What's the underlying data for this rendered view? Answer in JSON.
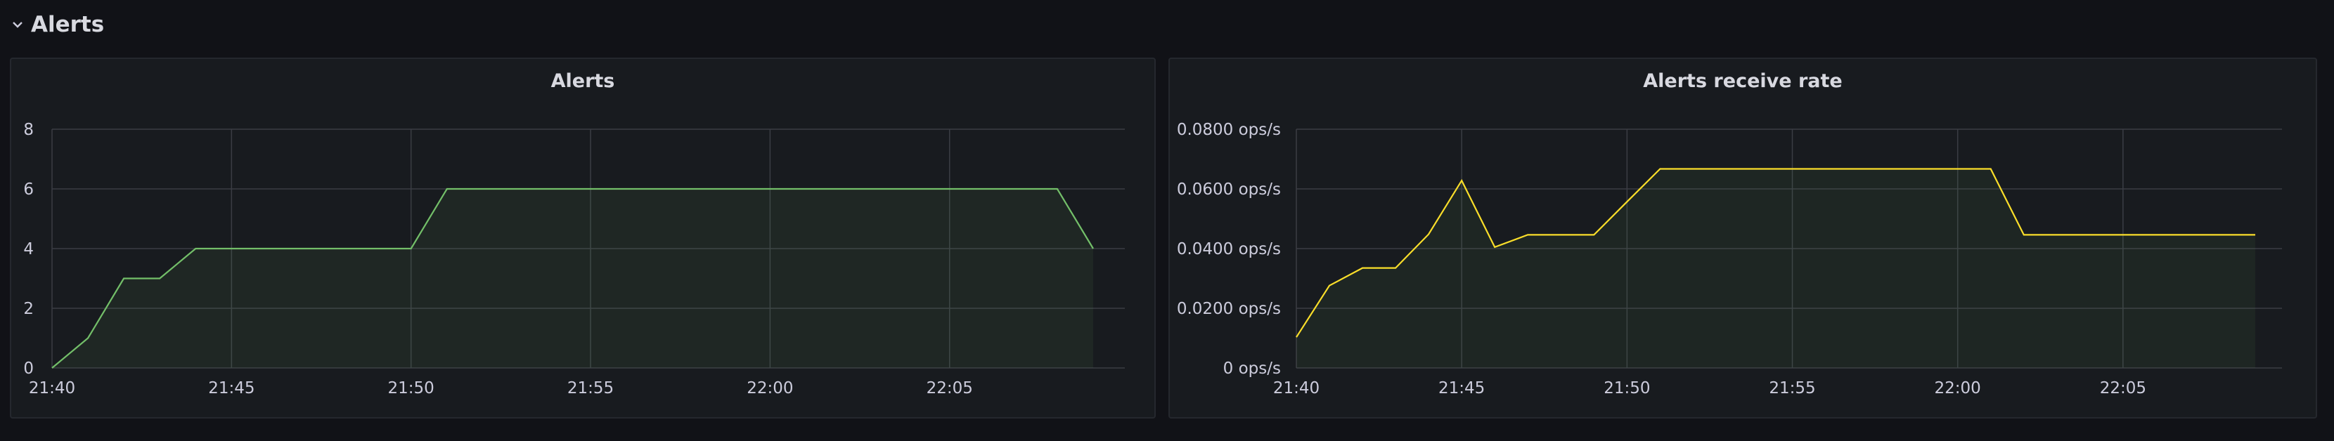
{
  "row": {
    "title": "Alerts",
    "chevron_icon": "chevron-down-icon"
  },
  "colors": {
    "background": "#111217",
    "panel_background": "#181b1f",
    "panel_border": "#25282e",
    "grid": "#3a3d44",
    "text": "#ccccdc",
    "alerts_series": "#73bf69",
    "rate_series": "#fade2a"
  },
  "chart_data": [
    {
      "type": "area",
      "title": "Alerts",
      "xlabel": "",
      "ylabel": "",
      "x": [
        "21:40",
        "21:41",
        "21:42",
        "21:43",
        "21:44",
        "21:45",
        "21:46",
        "21:47",
        "21:48",
        "21:49",
        "21:50",
        "21:51",
        "21:52",
        "21:53",
        "21:54",
        "21:55",
        "21:56",
        "21:57",
        "21:58",
        "21:59",
        "22:00",
        "22:01",
        "22:02",
        "22:03",
        "22:04",
        "22:05",
        "22:06",
        "22:07",
        "22:08",
        "22:09"
      ],
      "series": [
        {
          "name": "",
          "values": [
            0,
            1,
            3,
            3,
            4,
            4,
            4,
            4,
            4,
            4,
            4,
            6,
            6,
            6,
            6,
            6,
            6,
            6,
            6,
            6,
            6,
            6,
            6,
            6,
            6,
            6,
            6,
            6,
            6,
            4
          ]
        }
      ],
      "ylim": [
        0,
        8
      ],
      "yticks": [
        "0",
        "2",
        "4",
        "6",
        "8"
      ],
      "xticks": [
        "21:40",
        "21:45",
        "21:50",
        "21:55",
        "22:00",
        "22:05"
      ],
      "grid": true,
      "legend": "none"
    },
    {
      "type": "area",
      "title": "Alerts receive rate",
      "xlabel": "",
      "ylabel": "",
      "unit": "ops/s",
      "x": [
        "21:40",
        "21:41",
        "21:42",
        "21:43",
        "21:44",
        "21:45",
        "21:46",
        "21:47",
        "21:48",
        "21:49",
        "21:50",
        "21:51",
        "21:52",
        "21:53",
        "21:54",
        "21:55",
        "21:56",
        "21:57",
        "21:58",
        "21:59",
        "22:00",
        "22:01",
        "22:02",
        "22:03",
        "22:04",
        "22:05",
        "22:06",
        "22:07",
        "22:08",
        "22:09"
      ],
      "series": [
        {
          "name": "",
          "values": [
            0.0103,
            0.0276,
            0.0335,
            0.0335,
            0.0448,
            0.0628,
            0.0405,
            0.0446,
            0.0446,
            0.0446,
            0.0557,
            0.0667,
            0.0667,
            0.0667,
            0.0667,
            0.0667,
            0.0667,
            0.0667,
            0.0667,
            0.0667,
            0.0667,
            0.0667,
            0.0446,
            0.0446,
            0.0446,
            0.0446,
            0.0446,
            0.0446,
            0.0446,
            0.0446
          ]
        }
      ],
      "ylim": [
        0,
        0.08
      ],
      "yticks": [
        "0 ops/s",
        "0.0200 ops/s",
        "0.0400 ops/s",
        "0.0600 ops/s",
        "0.0800 ops/s"
      ],
      "xticks": [
        "21:40",
        "21:45",
        "21:50",
        "21:55",
        "22:00",
        "22:05"
      ],
      "grid": true,
      "legend": "none"
    }
  ]
}
